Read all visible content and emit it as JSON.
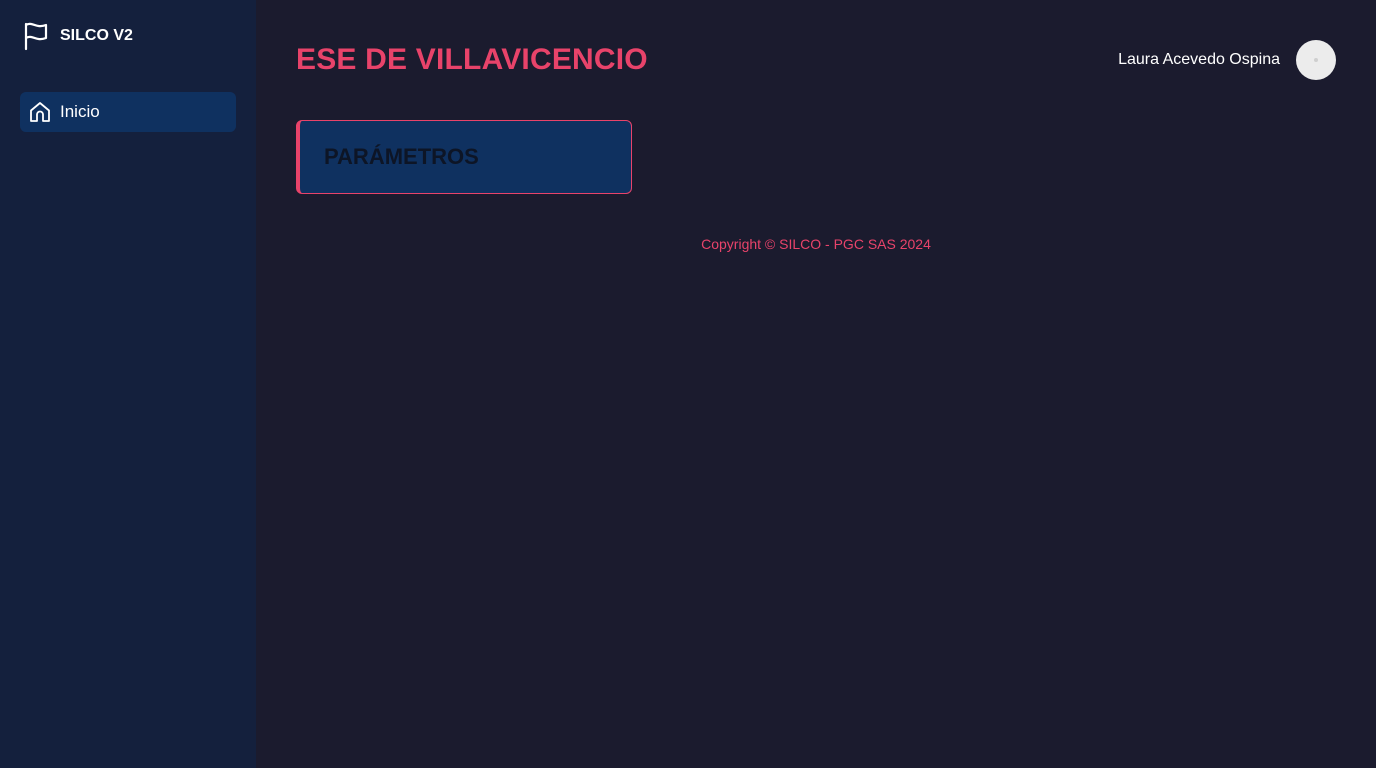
{
  "sidebar": {
    "brand": {
      "icon": "flag-icon",
      "name": "SILCO V2"
    },
    "items": [
      {
        "icon": "home-icon",
        "label": "Inicio",
        "active": true
      }
    ]
  },
  "header": {
    "title": "ESE DE VILLAVICENCIO",
    "user_name": "Laura Acevedo Ospina"
  },
  "cards": [
    {
      "title": "PARÁMETROS"
    }
  ],
  "footer": {
    "copyright": "Copyright © SILCO - PGC SAS 2024"
  },
  "colors": {
    "accent": "#e8436a",
    "sidebar_bg": "#14203d",
    "main_bg": "#1b1b2e",
    "active_item_bg": "#0f3160"
  }
}
